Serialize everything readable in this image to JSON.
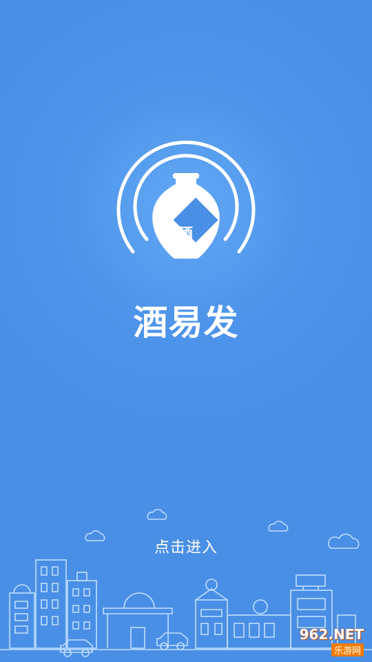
{
  "app": {
    "name": "酒易发",
    "logo_badge": "酒",
    "enter_label": "点击进入"
  },
  "watermark": {
    "site": "962.NET",
    "sub": "乐游网"
  },
  "colors": {
    "background": "#4d94ea",
    "foreground": "#ffffff",
    "watermark_orange": "#f07a00"
  }
}
